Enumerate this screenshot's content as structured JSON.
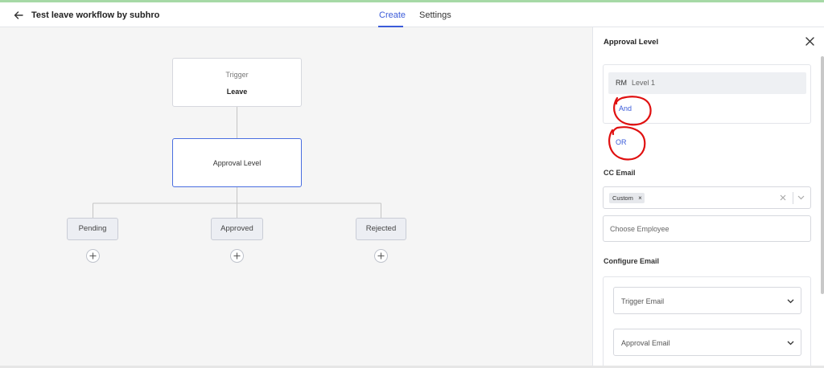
{
  "header": {
    "title": "Test leave workflow by subhro",
    "tabs": [
      {
        "label": "Create",
        "active": true
      },
      {
        "label": "Settings",
        "active": false
      }
    ]
  },
  "canvas": {
    "trigger": {
      "label": "Trigger",
      "value": "Leave"
    },
    "approval_node": {
      "label": "Approval Level"
    },
    "statuses": [
      {
        "label": "Pending"
      },
      {
        "label": "Approved"
      },
      {
        "label": "Rejected"
      }
    ]
  },
  "panel": {
    "title": "Approval Level",
    "level": {
      "role": "RM",
      "level": "Level 1"
    },
    "and_label": "And",
    "or_label": "OR",
    "cc_email": {
      "label": "CC Email",
      "chip": "Custom",
      "employee_placeholder": "Choose Employee"
    },
    "configure_email": {
      "label": "Configure Email",
      "trigger_email": "Trigger Email",
      "approval_email": "Approval Email"
    }
  },
  "colors": {
    "accent": "#3b5bd9",
    "annotation": "#e01010",
    "selected_border": "#4a6ee0"
  }
}
